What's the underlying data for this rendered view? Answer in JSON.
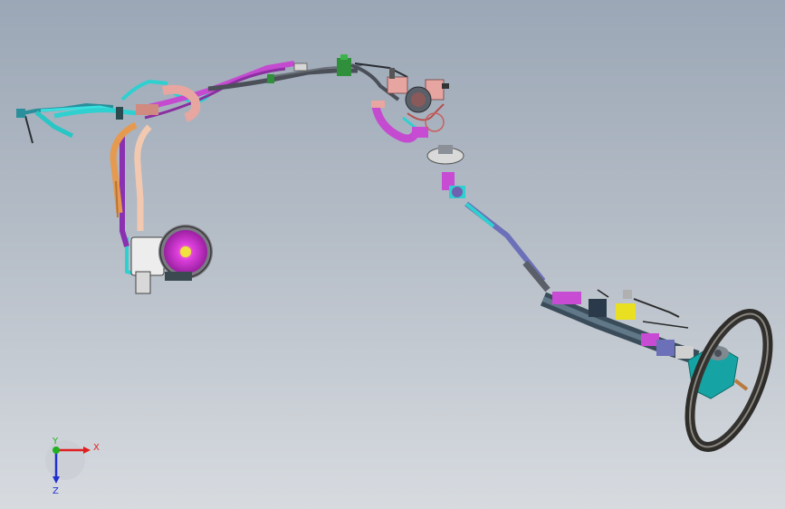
{
  "viewport": {
    "background_top": "#9ba7b6",
    "background_bottom": "#d7dbe0"
  },
  "colors": {
    "cyan_hose": "#2fd0d0",
    "magenta_hose": "#c44bd0",
    "pink_part": "#e8a6a0",
    "orange_hose": "#e59a50",
    "dark_tube": "#4a4f58",
    "green_clip": "#2f8f3a",
    "steering_shaft": "#6b70b8",
    "wheel_dark": "#3d3b38",
    "teal_hub": "#16a3a3",
    "yellow_bracket": "#e8e020",
    "reservoir_magenta": "#d12bd6"
  },
  "triad": {
    "x_label": "X",
    "y_label": "Y",
    "z_label": "Z",
    "x_color": "#e02020",
    "y_color": "#20b020",
    "z_color": "#2030d0"
  }
}
